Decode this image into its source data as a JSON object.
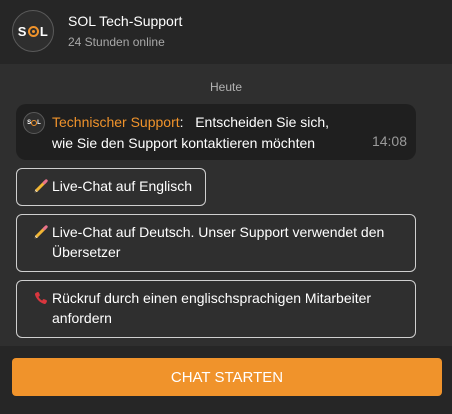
{
  "header": {
    "logo_text_left": "S",
    "logo_text_right": "L",
    "title": "SOL Tech-Support",
    "subtitle": "24 Stunden online"
  },
  "chat": {
    "date_separator": "Heute",
    "messages": [
      {
        "sender": "Technischer Support",
        "separator": ":",
        "text": "Entscheiden Sie sich, wie Sie den Support kontaktieren möchten",
        "time": "14:08"
      }
    ],
    "options": [
      {
        "icon": "pencil-icon",
        "label": "Live-Chat auf Englisch"
      },
      {
        "icon": "pencil-icon",
        "label": "Live-Chat auf Deutsch. Unser Support verwendet den Übersetzer"
      },
      {
        "icon": "telephone-receiver-icon",
        "label": "Rückruf durch einen englischsprachigen Mitarbeiter anfordern"
      }
    ]
  },
  "footer": {
    "start_label": "CHAT STARTEN"
  },
  "colors": {
    "accent": "#f0932b",
    "background": "#2f2f2f",
    "header_background": "#262626",
    "message_background": "#1f1f1f",
    "option_border": "#cfcfcf",
    "muted_text": "#a8a8a8"
  }
}
